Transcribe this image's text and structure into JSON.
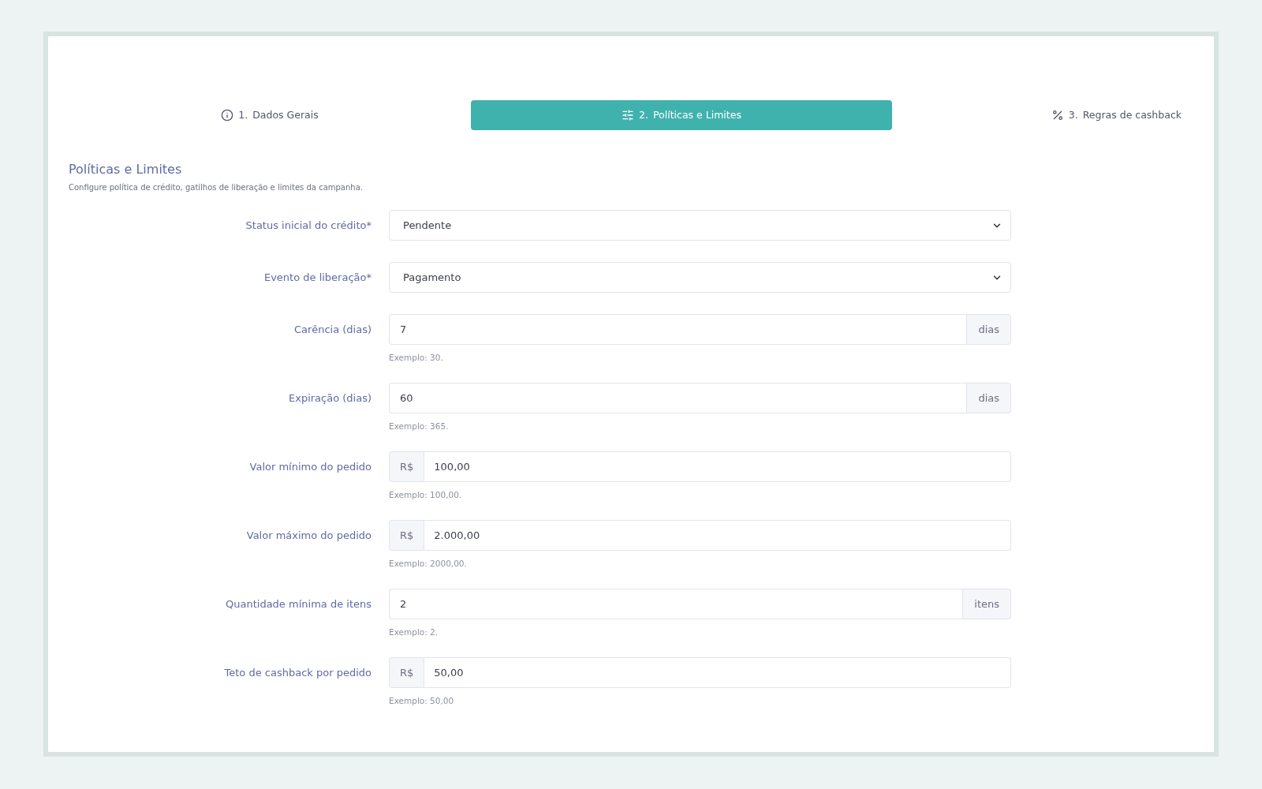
{
  "tabs": [
    {
      "step": "1.",
      "label": "Dados Gerais",
      "selected": false
    },
    {
      "step": "2.",
      "label": "Políticas e Limites",
      "selected": true
    },
    {
      "step": "3.",
      "label": "Regras de cashback",
      "selected": false
    }
  ],
  "section": {
    "title": "Políticas e Limites",
    "subtitle": "Configure política de crédito, gatilhos de liberação e limites da campanha."
  },
  "fields": [
    {
      "kind": "select",
      "label": "Status inicial do crédito*",
      "value": "Pendente"
    },
    {
      "kind": "select",
      "label": "Evento de liberação*",
      "value": "Pagamento"
    },
    {
      "kind": "input",
      "label": "Carência (dias)",
      "value": "7",
      "suffix": "dias",
      "hint": "Exemplo: 30."
    },
    {
      "kind": "input",
      "label": "Expiração (dias)",
      "value": "60",
      "suffix": "dias",
      "hint": "Exemplo: 365."
    },
    {
      "kind": "input",
      "label": "Valor mínimo do pedido",
      "prefix": "R$",
      "value": "100,00",
      "hint": "Exemplo: 100,00."
    },
    {
      "kind": "input",
      "label": "Valor máximo do pedido",
      "prefix": "R$",
      "value": "2.000,00",
      "hint": "Exemplo: 2000,00."
    },
    {
      "kind": "input",
      "label": "Quantidade mínima de itens",
      "value": "2",
      "suffix": "itens",
      "hint": "Exemplo: 2."
    },
    {
      "kind": "input",
      "label": "Teto de cashback por pedido",
      "prefix": "R$",
      "value": "50,00",
      "hint": "Exemplo: 50,00"
    }
  ]
}
